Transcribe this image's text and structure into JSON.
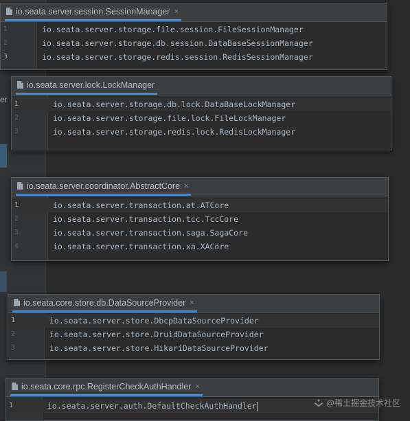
{
  "stray": {
    "left_text": "er"
  },
  "panels": [
    {
      "tab_title": "io.seata.server.session.SessionManager",
      "close_glyph": "×",
      "lines": [
        {
          "num": "1",
          "code": "io.seata.server.storage.file.session.FileSessionManager"
        },
        {
          "num": "2",
          "code": "io.seata.server.storage.db.session.DataBaseSessionManager"
        },
        {
          "num": "3",
          "code": "io.seata.server.storage.redis.session.RedisSessionManager"
        }
      ]
    },
    {
      "tab_title": "io.seata.server.lock.LockManager",
      "close_glyph": "×",
      "lines": [
        {
          "num": "1",
          "code": "io.seata.server.storage.db.lock.DataBaseLockManager"
        },
        {
          "num": "2",
          "code": "io.seata.server.storage.file.lock.FileLockManager"
        },
        {
          "num": "3",
          "code": "io.seata.server.storage.redis.lock.RedisLockManager"
        }
      ]
    },
    {
      "tab_title": "io.seata.server.coordinator.AbstractCore",
      "close_glyph": "×",
      "lines": [
        {
          "num": "1",
          "code": "io.seata.server.transaction.at.ATCore"
        },
        {
          "num": "2",
          "code": "io.seata.server.transaction.tcc.TccCore"
        },
        {
          "num": "3",
          "code": "io.seata.server.transaction.saga.SagaCore"
        },
        {
          "num": "4",
          "code": "io.seata.server.transaction.xa.XACore"
        }
      ]
    },
    {
      "tab_title": "io.seata.core.store.db.DataSourceProvider",
      "close_glyph": "×",
      "lines": [
        {
          "num": "1",
          "code": "io.seata.server.store.DbcpDataSourceProvider"
        },
        {
          "num": "2",
          "code": "io.seata.server.store.DruidDataSourceProvider"
        },
        {
          "num": "3",
          "code": "io.seata.server.store.HikariDataSourceProvider"
        }
      ]
    },
    {
      "tab_title": "io.seata.core.rpc.RegisterCheckAuthHandler",
      "close_glyph": "×",
      "lines": [
        {
          "num": "1",
          "code": "io.seata.server.auth.DefaultCheckAuthHandler"
        }
      ]
    }
  ],
  "watermark": {
    "text": "@稀土掘金技术社区"
  },
  "colors": {
    "accent": "#4a88c7",
    "code_text": "#a9b7c6",
    "tab_bar": "#3c3f41",
    "editor_bg": "#2b2b2b"
  },
  "icons": {
    "tab_icon": "file-icon",
    "close": "close-icon"
  }
}
